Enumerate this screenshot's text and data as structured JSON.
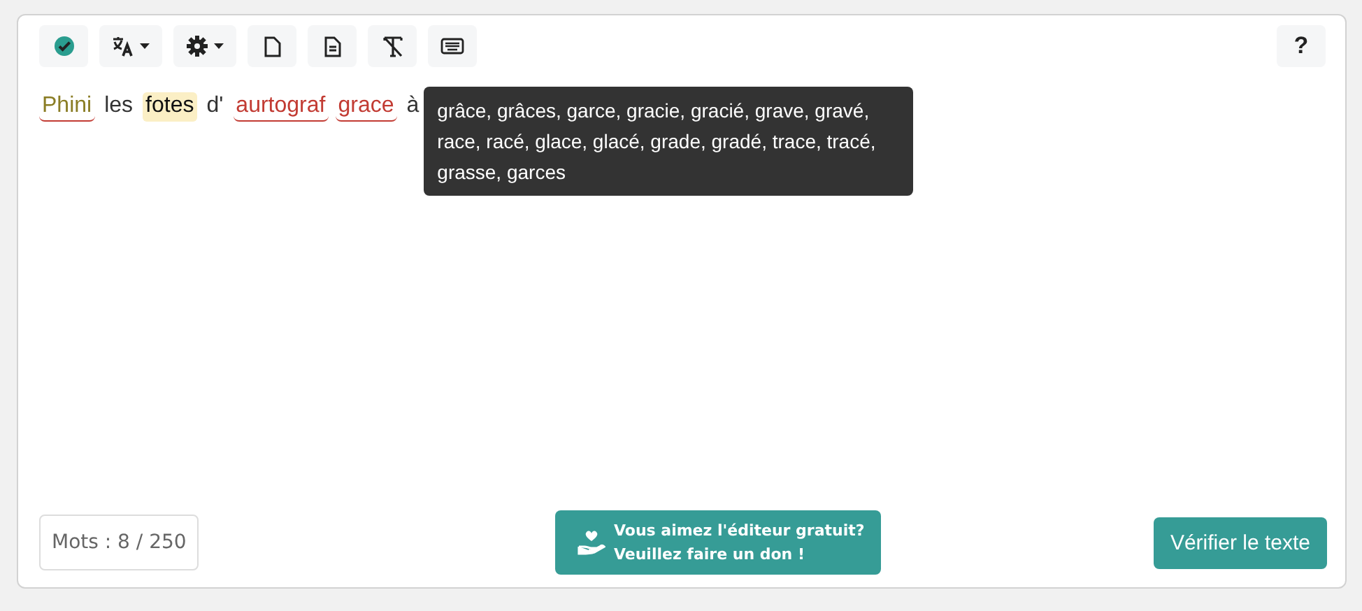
{
  "toolbar": [
    {
      "kind": "check",
      "dropdown": false
    },
    {
      "kind": "translate",
      "dropdown": true
    },
    {
      "kind": "settings",
      "dropdown": true
    },
    {
      "kind": "file",
      "dropdown": false
    },
    {
      "kind": "file-text",
      "dropdown": false
    },
    {
      "kind": "clear-format",
      "dropdown": false
    },
    {
      "kind": "keyboard",
      "dropdown": false
    }
  ],
  "help": "?",
  "words": [
    {
      "text": "Phini",
      "kind": "style"
    },
    {
      "text": "les",
      "kind": "plain"
    },
    {
      "text": "fotes",
      "kind": "highlight"
    },
    {
      "text": "d'",
      "kind": "plain"
    },
    {
      "text": "aurtograf",
      "kind": "error"
    },
    {
      "text": "grace",
      "kind": "error"
    },
    {
      "text": "à",
      "kind": "plain"
    }
  ],
  "tooltip": "grâce, grâces, garce, gracie, gracié, grave, gravé, race, racé, glace, glacé, grade, gradé, trace, tracé, grasse, garces",
  "word_count": "Mots : 8 / 250",
  "donate": [
    "Vous aimez l'éditeur gratuit?",
    "Veuillez faire un don !"
  ],
  "verify": "Vérifier le texte"
}
